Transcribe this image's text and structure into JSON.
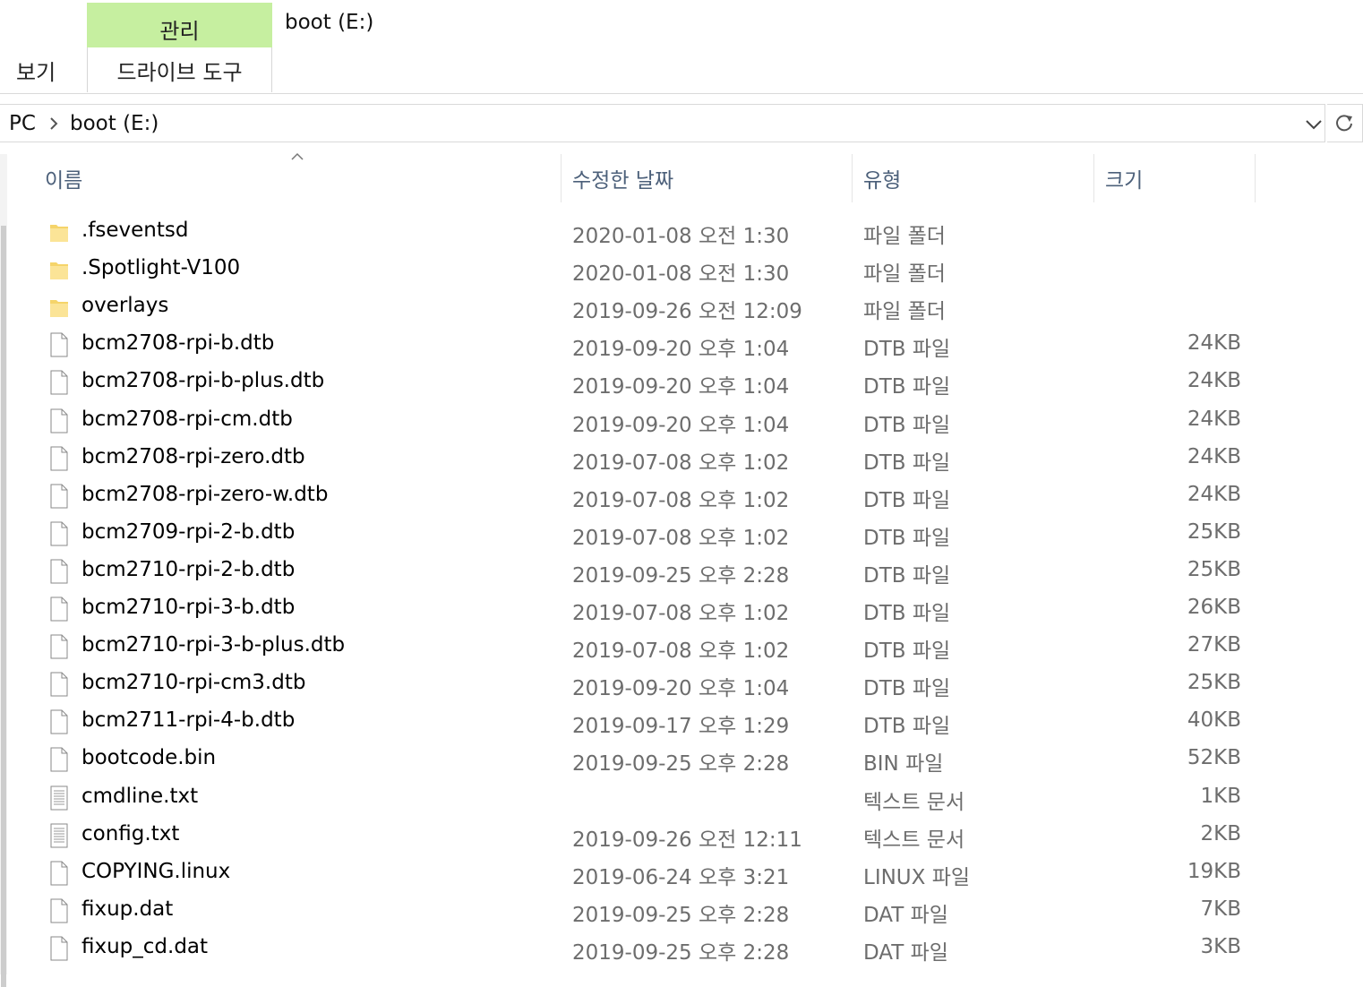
{
  "ribbon": {
    "manage_tab": "관리",
    "drive_tools_tab": "드라이브 도구",
    "view_tab": "보기",
    "window_title": "boot (E:)",
    "manage_color": "#c6efa0"
  },
  "address": {
    "crumbs": [
      "PC",
      "boot (E:)"
    ]
  },
  "columns": {
    "name": "이름",
    "date": "수정한 날짜",
    "type": "유형",
    "size": "크기"
  },
  "files": [
    {
      "icon": "folder-icon",
      "name": ".fseventsd",
      "date": "2020-01-08 오전 1:30",
      "type": "파일 폴더",
      "size": ""
    },
    {
      "icon": "folder-icon",
      "name": ".Spotlight-V100",
      "date": "2020-01-08 오전 1:30",
      "type": "파일 폴더",
      "size": ""
    },
    {
      "icon": "folder-icon",
      "name": "overlays",
      "date": "2019-09-26 오전 12:09",
      "type": "파일 폴더",
      "size": ""
    },
    {
      "icon": "file-icon",
      "name": "bcm2708-rpi-b.dtb",
      "date": "2019-09-20 오후 1:04",
      "type": "DTB 파일",
      "size": "24KB"
    },
    {
      "icon": "file-icon",
      "name": "bcm2708-rpi-b-plus.dtb",
      "date": "2019-09-20 오후 1:04",
      "type": "DTB 파일",
      "size": "24KB"
    },
    {
      "icon": "file-icon",
      "name": "bcm2708-rpi-cm.dtb",
      "date": "2019-09-20 오후 1:04",
      "type": "DTB 파일",
      "size": "24KB"
    },
    {
      "icon": "file-icon",
      "name": "bcm2708-rpi-zero.dtb",
      "date": "2019-07-08 오후 1:02",
      "type": "DTB 파일",
      "size": "24KB"
    },
    {
      "icon": "file-icon",
      "name": "bcm2708-rpi-zero-w.dtb",
      "date": "2019-07-08 오후 1:02",
      "type": "DTB 파일",
      "size": "24KB"
    },
    {
      "icon": "file-icon",
      "name": "bcm2709-rpi-2-b.dtb",
      "date": "2019-07-08 오후 1:02",
      "type": "DTB 파일",
      "size": "25KB"
    },
    {
      "icon": "file-icon",
      "name": "bcm2710-rpi-2-b.dtb",
      "date": "2019-09-25 오후 2:28",
      "type": "DTB 파일",
      "size": "25KB"
    },
    {
      "icon": "file-icon",
      "name": "bcm2710-rpi-3-b.dtb",
      "date": "2019-07-08 오후 1:02",
      "type": "DTB 파일",
      "size": "26KB"
    },
    {
      "icon": "file-icon",
      "name": "bcm2710-rpi-3-b-plus.dtb",
      "date": "2019-07-08 오후 1:02",
      "type": "DTB 파일",
      "size": "27KB"
    },
    {
      "icon": "file-icon",
      "name": "bcm2710-rpi-cm3.dtb",
      "date": "2019-09-20 오후 1:04",
      "type": "DTB 파일",
      "size": "25KB"
    },
    {
      "icon": "file-icon",
      "name": "bcm2711-rpi-4-b.dtb",
      "date": "2019-09-17 오후 1:29",
      "type": "DTB 파일",
      "size": "40KB"
    },
    {
      "icon": "file-icon",
      "name": "bootcode.bin",
      "date": "2019-09-25 오후 2:28",
      "type": "BIN 파일",
      "size": "52KB"
    },
    {
      "icon": "text-file-icon",
      "name": "cmdline.txt",
      "date": "",
      "type": "텍스트 문서",
      "size": "1KB"
    },
    {
      "icon": "text-file-icon",
      "name": "config.txt",
      "date": "2019-09-26 오전 12:11",
      "type": "텍스트 문서",
      "size": "2KB"
    },
    {
      "icon": "file-icon",
      "name": "COPYING.linux",
      "date": "2019-06-24 오후 3:21",
      "type": "LINUX 파일",
      "size": "19KB"
    },
    {
      "icon": "file-icon",
      "name": "fixup.dat",
      "date": "2019-09-25 오후 2:28",
      "type": "DAT 파일",
      "size": "7KB"
    },
    {
      "icon": "file-icon",
      "name": "fixup_cd.dat",
      "date": "2019-09-25 오후 2:28",
      "type": "DAT 파일",
      "size": "3KB"
    }
  ]
}
